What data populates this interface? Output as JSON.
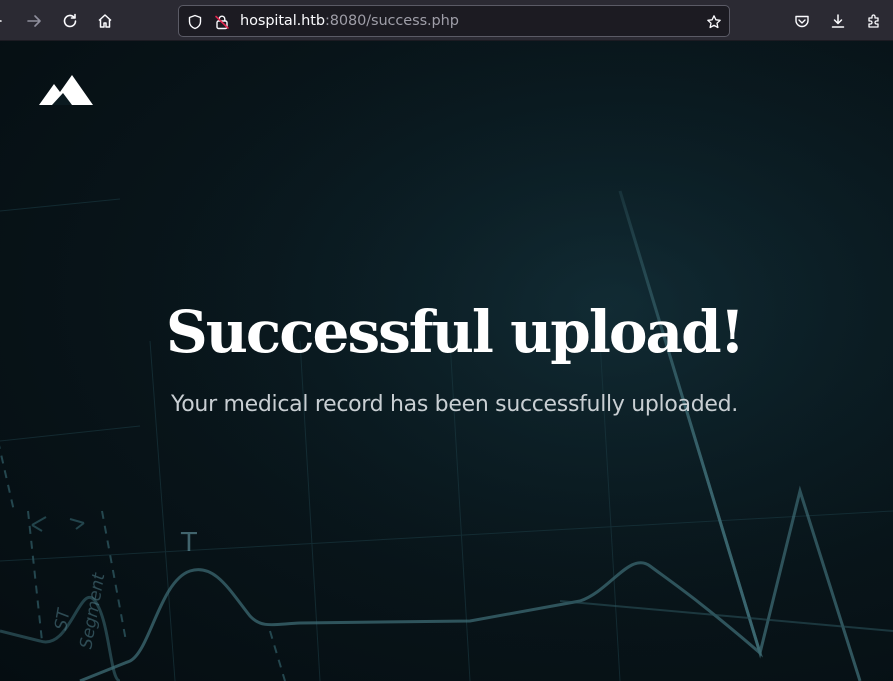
{
  "browser": {
    "url_host": "hospital.htb",
    "url_rest": ":8080/success.php",
    "icons": {
      "back": "arrow-left-icon",
      "forward": "arrow-right-icon",
      "reload": "reload-icon",
      "home": "home-icon",
      "tracking": "shield-icon",
      "security": "insecure-lock-icon",
      "bookmark": "star-icon",
      "pocket": "pocket-icon",
      "downloads": "download-icon",
      "extensions": "puzzle-icon"
    }
  },
  "page": {
    "logo": "mountain-logo-icon",
    "title": "Successful upload!",
    "subtitle": "Your medical record has been successfully uploaded.",
    "background_labels": {
      "t_wave": "T",
      "st_segment_line1": "ST",
      "st_segment_line2": "Segment"
    }
  },
  "colors": {
    "toolbar": "#2b2a33",
    "urlbar": "#1c1b22",
    "page_bg": "#081419",
    "ecg_line": "#3d6b74",
    "title": "#ffffff",
    "subtitle": "#c9cfd3"
  }
}
